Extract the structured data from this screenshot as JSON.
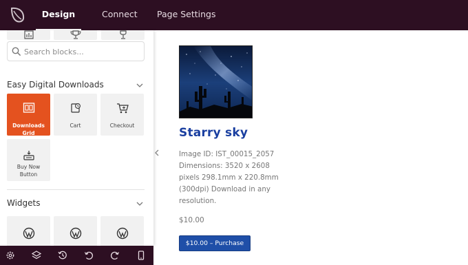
{
  "topbar": {
    "tabs": [
      {
        "label": "Design",
        "active": true
      },
      {
        "label": "Connect",
        "active": false
      },
      {
        "label": "Page Settings",
        "active": false
      }
    ],
    "logo_icon": "leaf-logo-icon",
    "background": "#2d0f22"
  },
  "sidebar": {
    "search": {
      "placeholder": "Search blocks...",
      "value": ""
    },
    "sections": [
      {
        "title": "Easy Digital Downloads",
        "blocks": [
          {
            "label": "Downloads Grid",
            "icon": "grid-icon",
            "active": true
          },
          {
            "label": "Cart",
            "icon": "cart-clock-icon",
            "active": false
          },
          {
            "label": "Checkout",
            "icon": "checkout-cart-icon",
            "active": false
          },
          {
            "label": "Buy Now Button",
            "icon": "buy-now-icon",
            "active": false
          }
        ]
      },
      {
        "title": "Widgets",
        "blocks": [
          {
            "label": "",
            "icon": "wordpress-icon"
          },
          {
            "label": "",
            "icon": "wordpress-icon"
          },
          {
            "label": "",
            "icon": "wordpress-icon"
          }
        ]
      }
    ],
    "bottom_toolbar": [
      "settings-icon",
      "layers-icon",
      "history-icon",
      "undo-icon",
      "redo-icon",
      "mobile-preview-icon"
    ],
    "accent": "#e4521f"
  },
  "product": {
    "title": "Starry sky",
    "description": "Image ID: IST_00015_2057 Dimensions: 3520 x 2608 pixels 298.1mm x 220.8mm (300dpi) Download in any resolution.",
    "price": "$10.00",
    "purchase_label": "$10.00 – Purchase",
    "title_color": "#1a3fa0",
    "button_color": "#1f4fa8"
  }
}
